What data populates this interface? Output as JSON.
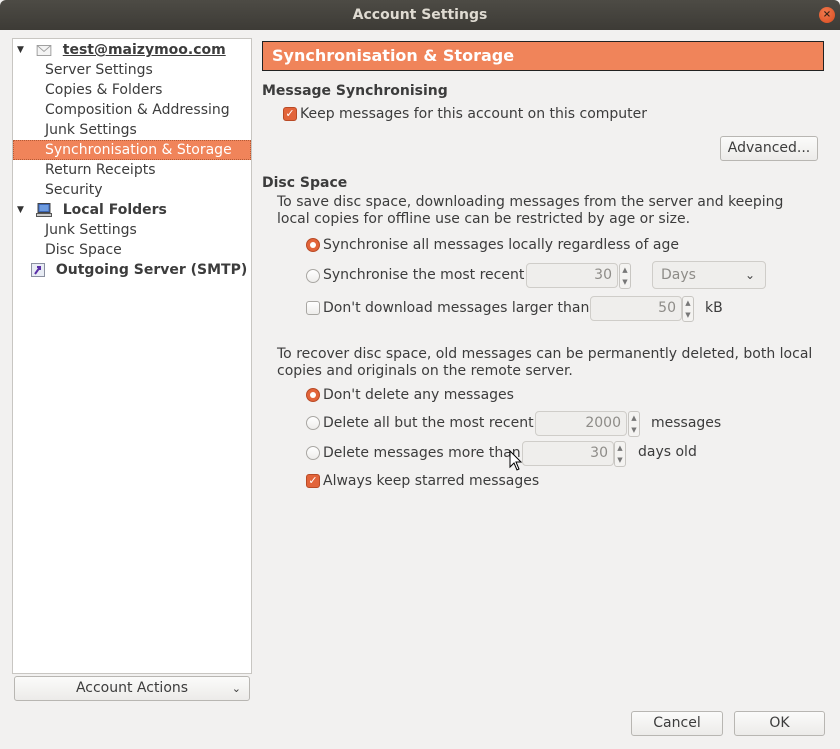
{
  "window": {
    "title": "Account Settings",
    "close_icon": "×"
  },
  "tree": {
    "account": {
      "label": "test@maizymoo.com",
      "icon": "envelope-icon"
    },
    "account_children": [
      {
        "label": "Server Settings",
        "selected": false
      },
      {
        "label": "Copies & Folders",
        "selected": false
      },
      {
        "label": "Composition & Addressing",
        "selected": false
      },
      {
        "label": "Junk Settings",
        "selected": false
      },
      {
        "label": "Synchronisation & Storage",
        "selected": true
      },
      {
        "label": "Return Receipts",
        "selected": false
      },
      {
        "label": "Security",
        "selected": false
      }
    ],
    "local_folders": {
      "label": "Local Folders",
      "icon": "computer-icon"
    },
    "local_children": [
      {
        "label": "Junk Settings"
      },
      {
        "label": "Disc Space"
      }
    ],
    "outgoing": {
      "label": "Outgoing Server (SMTP)",
      "icon": "outgoing-server-icon"
    }
  },
  "account_actions": {
    "label": "Account Actions"
  },
  "panel": {
    "title": "Synchronisation & Storage",
    "message_sync": {
      "heading": "Message Synchronising",
      "keep_messages": {
        "label": "Keep messages for this account on this computer",
        "checked": true
      },
      "advanced_button": "Advanced..."
    },
    "disc_space": {
      "heading": "Disc Space",
      "description": "To save disc space, downloading messages from the server and keeping local copies for offline use can be restricted by age or size.",
      "sync_all": {
        "label": "Synchronise all messages locally regardless of age",
        "selected": true
      },
      "sync_recent": {
        "label": "Synchronise the most recent",
        "selected": false,
        "value": "30",
        "unit": "Days"
      },
      "dont_download": {
        "label": "Don't download messages larger than",
        "checked": false,
        "value": "50",
        "unit": "kB"
      },
      "recover_description": "To recover disc space, old messages can be permanently deleted, both local copies and originals on the remote server.",
      "dont_delete": {
        "label": "Don't delete any messages",
        "selected": true
      },
      "delete_all_but": {
        "label": "Delete all but the most recent",
        "selected": false,
        "value": "2000",
        "unit": "messages"
      },
      "delete_older": {
        "label": "Delete messages more than",
        "selected": false,
        "value": "30",
        "unit": "days old"
      },
      "keep_starred": {
        "label": "Always keep starred messages",
        "checked": true
      }
    }
  },
  "footer": {
    "cancel": "Cancel",
    "ok": "OK"
  }
}
